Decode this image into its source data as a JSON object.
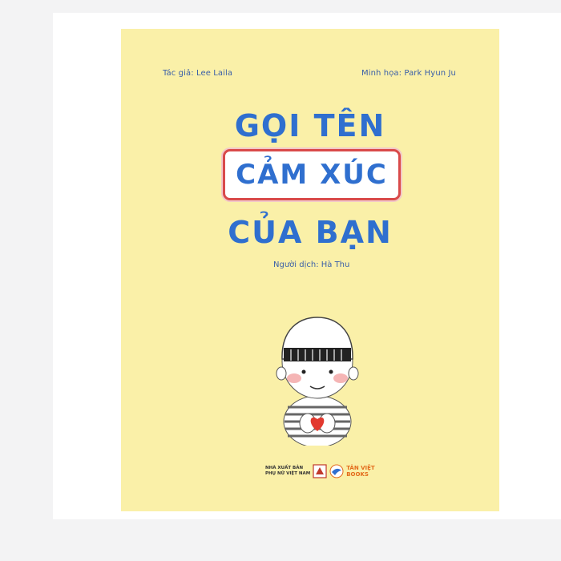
{
  "cover": {
    "author": "Tác giả: Lee Laila",
    "illustrator": "Minh họa: Park Hyun Ju",
    "title_line1": "GỌI TÊN",
    "title_line2": "CẢM XÚC",
    "title_line3": "CỦA BẠN",
    "translator": "Người dịch: Hà Thu",
    "publisher_line1": "NHÀ XUẤT BẢN",
    "publisher_line2": "PHỤ NỮ VIỆT NAM",
    "imprint_line1": "TÂN VIỆT",
    "imprint_line2": "BOOKS"
  },
  "colors": {
    "cover_background": "#faf0a8",
    "title_blue": "#2f6fcf",
    "box_border_red": "#d94a4a",
    "imprint_orange": "#e36c1c"
  }
}
